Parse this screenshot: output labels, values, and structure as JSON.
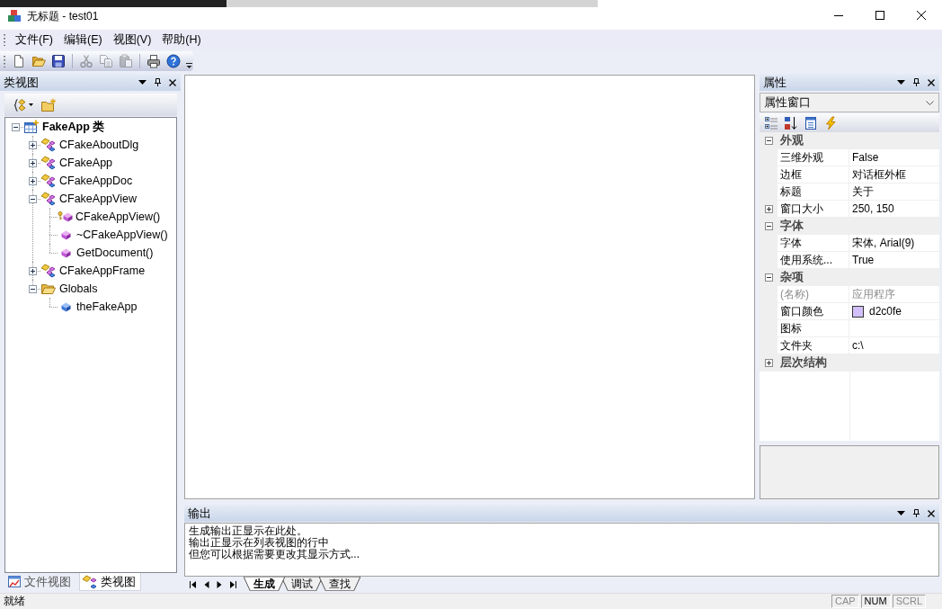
{
  "window": {
    "title": "无标题 - test01"
  },
  "menu": [
    "文件(F)",
    "编辑(E)",
    "视图(V)",
    "帮助(H)"
  ],
  "toolbar": [
    [
      {
        "kind": "new",
        "disabled": false
      },
      {
        "kind": "open",
        "disabled": false
      },
      {
        "kind": "save",
        "disabled": false
      }
    ],
    [
      {
        "kind": "cut",
        "disabled": true
      },
      {
        "kind": "copy",
        "disabled": true
      },
      {
        "kind": "paste",
        "disabled": true
      }
    ],
    [
      {
        "kind": "print",
        "disabled": false
      },
      {
        "kind": "help",
        "disabled": false
      }
    ]
  ],
  "class_view": {
    "title": "类视图",
    "tree": [
      {
        "label": "FakeApp 类",
        "kind": "project",
        "expanded": true,
        "children": [
          {
            "label": "CFakeAboutDlg",
            "kind": "class",
            "expanded": false
          },
          {
            "label": "CFakeApp",
            "kind": "class",
            "expanded": false
          },
          {
            "label": "CFakeAppDoc",
            "kind": "class",
            "expanded": false
          },
          {
            "label": "CFakeAppView",
            "kind": "class",
            "expanded": true,
            "children": [
              {
                "label": "CFakeAppView()",
                "kind": "protected-method"
              },
              {
                "label": "~CFakeAppView()",
                "kind": "method"
              },
              {
                "label": "GetDocument()",
                "kind": "method"
              }
            ]
          },
          {
            "label": "CFakeAppFrame",
            "kind": "class",
            "expanded": false
          },
          {
            "label": "Globals",
            "kind": "folder",
            "expanded": true,
            "children": [
              {
                "label": "theFakeApp",
                "kind": "variable"
              }
            ]
          }
        ]
      }
    ],
    "tabs": [
      {
        "label": "文件视图",
        "selected": false
      },
      {
        "label": "类视图",
        "selected": true
      }
    ]
  },
  "properties": {
    "title": "属性",
    "object": "属性窗口",
    "categories": [
      {
        "name": "外观",
        "expanded": true,
        "items": [
          {
            "name": "三维外观",
            "value": "False",
            "kind": "text",
            "disabled": false
          },
          {
            "name": "边框",
            "value": "对话框外框",
            "kind": "text",
            "disabled": false
          },
          {
            "name": "标题",
            "value": "关于",
            "kind": "text",
            "disabled": false
          },
          {
            "name": "窗口大小",
            "value": "250, 150",
            "kind": "group",
            "disabled": false
          }
        ]
      },
      {
        "name": "字体",
        "expanded": true,
        "items": [
          {
            "name": "字体",
            "value": "宋体, Arial(9)",
            "kind": "text",
            "disabled": false
          },
          {
            "name": "使用系统...",
            "value": "True",
            "kind": "text",
            "disabled": false
          }
        ]
      },
      {
        "name": "杂项",
        "expanded": true,
        "items": [
          {
            "name": "(名称)",
            "value": "应用程序",
            "kind": "text",
            "disabled": true
          },
          {
            "name": "窗口颜色",
            "value": "d2c0fe",
            "kind": "color",
            "color": "#d2c0fe",
            "disabled": false
          },
          {
            "name": "图标",
            "kind": "text",
            "disabled": false
          },
          {
            "name": "文件夹",
            "value": "c:\\",
            "kind": "text",
            "disabled": false
          }
        ]
      },
      {
        "name": "层次结构",
        "expanded": false
      }
    ]
  },
  "output": {
    "title": "输出",
    "lines": [
      "生成输出正显示在此处。",
      "输出正显示在列表视图的行中",
      "但您可以根据需要更改其显示方式..."
    ],
    "tabs": [
      {
        "label": "生成",
        "selected": true
      },
      {
        "label": "调试",
        "selected": false
      },
      {
        "label": "查找",
        "selected": false
      }
    ]
  },
  "status_bar": {
    "text": "就绪",
    "indicators": [
      {
        "label": "CAP",
        "active": false
      },
      {
        "label": "NUM",
        "active": true
      },
      {
        "label": "SCRL",
        "active": false
      }
    ]
  }
}
